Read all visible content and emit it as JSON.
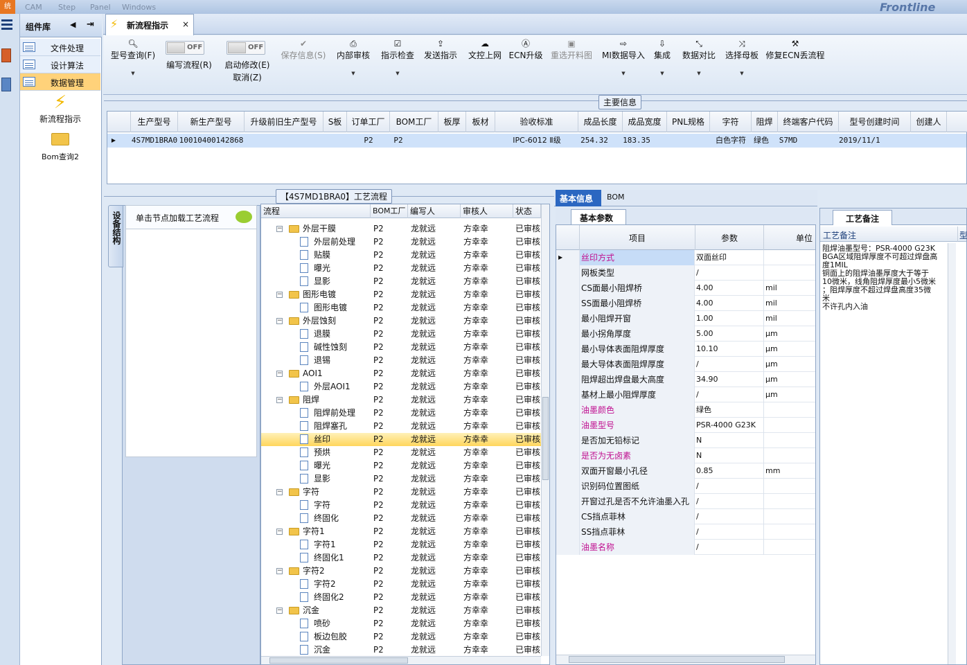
{
  "title_bar": {
    "app_fragment": "统",
    "menus": [
      "CAM",
      "Step",
      "Panel",
      "Windows"
    ],
    "right_text": "Frontline"
  },
  "component_panel": {
    "title": "组件库",
    "items": [
      {
        "label": "文件处理"
      },
      {
        "label": "设计算法"
      },
      {
        "label": "数据管理"
      }
    ],
    "launchers": [
      {
        "label": "新流程指示"
      },
      {
        "label": "Bom查询2"
      }
    ]
  },
  "tab": {
    "label": "新流程指示",
    "close": "×"
  },
  "toolbar": {
    "model_query": "型号查询(F)",
    "toggle_off": "OFF",
    "write_flow": "编写流程(R)",
    "start_modify": "启动修改(E)",
    "cancel": "取消(Z)",
    "save_info": "保存信息(S)",
    "internal_review": "内部审核",
    "check": "指示检查",
    "send": "发送指示",
    "upload": "文控上网",
    "ecn": "ECN升级",
    "reselect": "重选开料图",
    "mi_import": "MI数据导入",
    "integrate": "集成",
    "compare": "数据对比",
    "select_mother": "选择母板",
    "fix_ecn": "修复ECN丢流程"
  },
  "main_info": {
    "label": "主要信息",
    "columns": [
      "生产型号",
      "新生产型号",
      "升级前旧生产型号",
      "S板",
      "订单工厂",
      "BOM工厂",
      "板厚",
      "板材",
      "验收标准",
      "成品长度",
      "成品宽度",
      "PNL规格",
      "字符",
      "阻焊",
      "终端客户代码",
      "型号创建时间",
      "创建人"
    ],
    "row": {
      "model": "4S7MD1BRA0",
      "new_model": "10010400142868",
      "order_factory": "P2",
      "bom_factory": "P2",
      "standard": "IPC-6012 Ⅱ级",
      "length": "254.32",
      "width": "183.35",
      "char": "白色字符",
      "mask": "绿色",
      "customer": "S7MD",
      "created": "2019/11/1"
    }
  },
  "process_panel": {
    "label": "【4S7MD1BRA0】工艺流程",
    "vertical_tab": "设备结构",
    "load_hint": "单击节点加载工艺流程",
    "columns": [
      "流程",
      "BOM工厂",
      "编写人",
      "审核人",
      "状态"
    ],
    "rows": [
      {
        "name": "外层干膜",
        "type": "folder",
        "factory": "P2",
        "writer": "龙就远",
        "reviewer": "方幸幸",
        "status": "已审核"
      },
      {
        "name": "外层前处理",
        "type": "doc",
        "factory": "P2",
        "writer": "龙就远",
        "reviewer": "方幸幸",
        "status": "已审核"
      },
      {
        "name": "贴膜",
        "type": "doc",
        "factory": "P2",
        "writer": "龙就远",
        "reviewer": "方幸幸",
        "status": "已审核"
      },
      {
        "name": "曝光",
        "type": "doc",
        "factory": "P2",
        "writer": "龙就远",
        "reviewer": "方幸幸",
        "status": "已审核"
      },
      {
        "name": "显影",
        "type": "doc",
        "factory": "P2",
        "writer": "龙就远",
        "reviewer": "方幸幸",
        "status": "已审核"
      },
      {
        "name": "图形电镀",
        "type": "folder",
        "factory": "P2",
        "writer": "龙就远",
        "reviewer": "方幸幸",
        "status": "已审核"
      },
      {
        "name": "图形电镀",
        "type": "doc",
        "factory": "P2",
        "writer": "龙就远",
        "reviewer": "方幸幸",
        "status": "已审核"
      },
      {
        "name": "外层蚀刻",
        "type": "folder",
        "factory": "P2",
        "writer": "龙就远",
        "reviewer": "方幸幸",
        "status": "已审核"
      },
      {
        "name": "退膜",
        "type": "doc",
        "factory": "P2",
        "writer": "龙就远",
        "reviewer": "方幸幸",
        "status": "已审核"
      },
      {
        "name": "碱性蚀刻",
        "type": "doc",
        "factory": "P2",
        "writer": "龙就远",
        "reviewer": "方幸幸",
        "status": "已审核"
      },
      {
        "name": "退锡",
        "type": "doc",
        "factory": "P2",
        "writer": "龙就远",
        "reviewer": "方幸幸",
        "status": "已审核"
      },
      {
        "name": "AOI1",
        "type": "folder",
        "factory": "P2",
        "writer": "龙就远",
        "reviewer": "方幸幸",
        "status": "已审核"
      },
      {
        "name": "外层AOI1",
        "type": "doc",
        "factory": "P2",
        "writer": "龙就远",
        "reviewer": "方幸幸",
        "status": "已审核"
      },
      {
        "name": "阻焊",
        "type": "folder",
        "factory": "P2",
        "writer": "龙就远",
        "reviewer": "方幸幸",
        "status": "已审核"
      },
      {
        "name": "阻焊前处理",
        "type": "doc",
        "factory": "P2",
        "writer": "龙就远",
        "reviewer": "方幸幸",
        "status": "已审核"
      },
      {
        "name": "阻焊塞孔",
        "type": "doc",
        "factory": "P2",
        "writer": "龙就远",
        "reviewer": "方幸幸",
        "status": "已审核"
      },
      {
        "name": "丝印",
        "type": "doc",
        "factory": "P2",
        "writer": "龙就远",
        "reviewer": "方幸幸",
        "status": "已审核",
        "selected": true
      },
      {
        "name": "预烘",
        "type": "doc",
        "factory": "P2",
        "writer": "龙就远",
        "reviewer": "方幸幸",
        "status": "已审核"
      },
      {
        "name": "曝光",
        "type": "doc",
        "factory": "P2",
        "writer": "龙就远",
        "reviewer": "方幸幸",
        "status": "已审核"
      },
      {
        "name": "显影",
        "type": "doc",
        "factory": "P2",
        "writer": "龙就远",
        "reviewer": "方幸幸",
        "status": "已审核"
      },
      {
        "name": "字符",
        "type": "folder",
        "factory": "P2",
        "writer": "龙就远",
        "reviewer": "方幸幸",
        "status": "已审核"
      },
      {
        "name": "字符",
        "type": "doc",
        "factory": "P2",
        "writer": "龙就远",
        "reviewer": "方幸幸",
        "status": "已审核"
      },
      {
        "name": "终固化",
        "type": "doc",
        "factory": "P2",
        "writer": "龙就远",
        "reviewer": "方幸幸",
        "status": "已审核"
      },
      {
        "name": "字符1",
        "type": "folder",
        "factory": "P2",
        "writer": "龙就远",
        "reviewer": "方幸幸",
        "status": "已审核"
      },
      {
        "name": "字符1",
        "type": "doc",
        "factory": "P2",
        "writer": "龙就远",
        "reviewer": "方幸幸",
        "status": "已审核"
      },
      {
        "name": "终固化1",
        "type": "doc",
        "factory": "P2",
        "writer": "龙就远",
        "reviewer": "方幸幸",
        "status": "已审核"
      },
      {
        "name": "字符2",
        "type": "folder",
        "factory": "P2",
        "writer": "龙就远",
        "reviewer": "方幸幸",
        "status": "已审核"
      },
      {
        "name": "字符2",
        "type": "doc",
        "factory": "P2",
        "writer": "龙就远",
        "reviewer": "方幸幸",
        "status": "已审核"
      },
      {
        "name": "终固化2",
        "type": "doc",
        "factory": "P2",
        "writer": "龙就远",
        "reviewer": "方幸幸",
        "status": "已审核"
      },
      {
        "name": "沉金",
        "type": "folder",
        "factory": "P2",
        "writer": "龙就远",
        "reviewer": "方幸幸",
        "status": "已审核"
      },
      {
        "name": "喷砂",
        "type": "doc",
        "factory": "P2",
        "writer": "龙就远",
        "reviewer": "方幸幸",
        "status": "已审核"
      },
      {
        "name": "板边包胶",
        "type": "doc",
        "factory": "P2",
        "writer": "龙就远",
        "reviewer": "方幸幸",
        "status": "已审核"
      },
      {
        "name": "沉金",
        "type": "doc",
        "factory": "P2",
        "writer": "龙就远",
        "reviewer": "方幸幸",
        "status": "已审核"
      }
    ]
  },
  "info_tabs": {
    "basic": "基本信息",
    "bom": "BOM"
  },
  "params": {
    "subtab": "基本参数",
    "col_item": "项目",
    "col_value": "参数",
    "col_unit": "单位",
    "rows": [
      {
        "item": "丝印方式",
        "value": "双面丝印",
        "unit": "",
        "pink": true
      },
      {
        "item": "网板类型",
        "value": "/",
        "unit": ""
      },
      {
        "item": "CS面最小阻焊桥",
        "value": "4.00",
        "unit": "mil"
      },
      {
        "item": "SS面最小阻焊桥",
        "value": "4.00",
        "unit": "mil"
      },
      {
        "item": "最小阻焊开窗",
        "value": "1.00",
        "unit": "mil"
      },
      {
        "item": "最小拐角厚度",
        "value": "5.00",
        "unit": "μm"
      },
      {
        "item": "最小导体表面阻焊厚度",
        "value": "10.10",
        "unit": "μm"
      },
      {
        "item": "最大导体表面阻焊厚度",
        "value": "/",
        "unit": "μm"
      },
      {
        "item": "阻焊超出焊盘最大高度",
        "value": "34.90",
        "unit": "μm"
      },
      {
        "item": "基材上最小阻焊厚度",
        "value": "/",
        "unit": "μm"
      },
      {
        "item": "油墨颜色",
        "value": "绿色",
        "unit": "",
        "pink": true
      },
      {
        "item": "油墨型号",
        "value": "PSR-4000 G23K",
        "unit": "",
        "pink": true
      },
      {
        "item": "是否加无铅标记",
        "value": "N",
        "unit": ""
      },
      {
        "item": "是否为无卤素",
        "value": "N",
        "unit": "",
        "pink": true
      },
      {
        "item": "双面开窗最小孔径",
        "value": "0.85",
        "unit": "mm"
      },
      {
        "item": "识别码位置图纸",
        "value": "/",
        "unit": ""
      },
      {
        "item": "开窗过孔是否不允许油墨入孔",
        "value": "/",
        "unit": ""
      },
      {
        "item": "CS挡点菲林",
        "value": "/",
        "unit": ""
      },
      {
        "item": "SS挡点菲林",
        "value": "/",
        "unit": ""
      },
      {
        "item": "油墨名称",
        "value": "/",
        "unit": "",
        "pink": true
      }
    ]
  },
  "remark": {
    "tab": "工艺备注",
    "header": "工艺备注",
    "header2": "型",
    "lines": [
      "阻焊油墨型号：PSR-4000 G23K",
      "BGA区域阻焊厚度不可超过焊盘高",
      "度1MIL",
      "铜面上的阻焊油墨厚度大于等于",
      "10微米，线角阻焊厚度最小5微米",
      "；阻焊厚度不超过焊盘高度35微",
      "米",
      "不许孔内入油"
    ]
  }
}
